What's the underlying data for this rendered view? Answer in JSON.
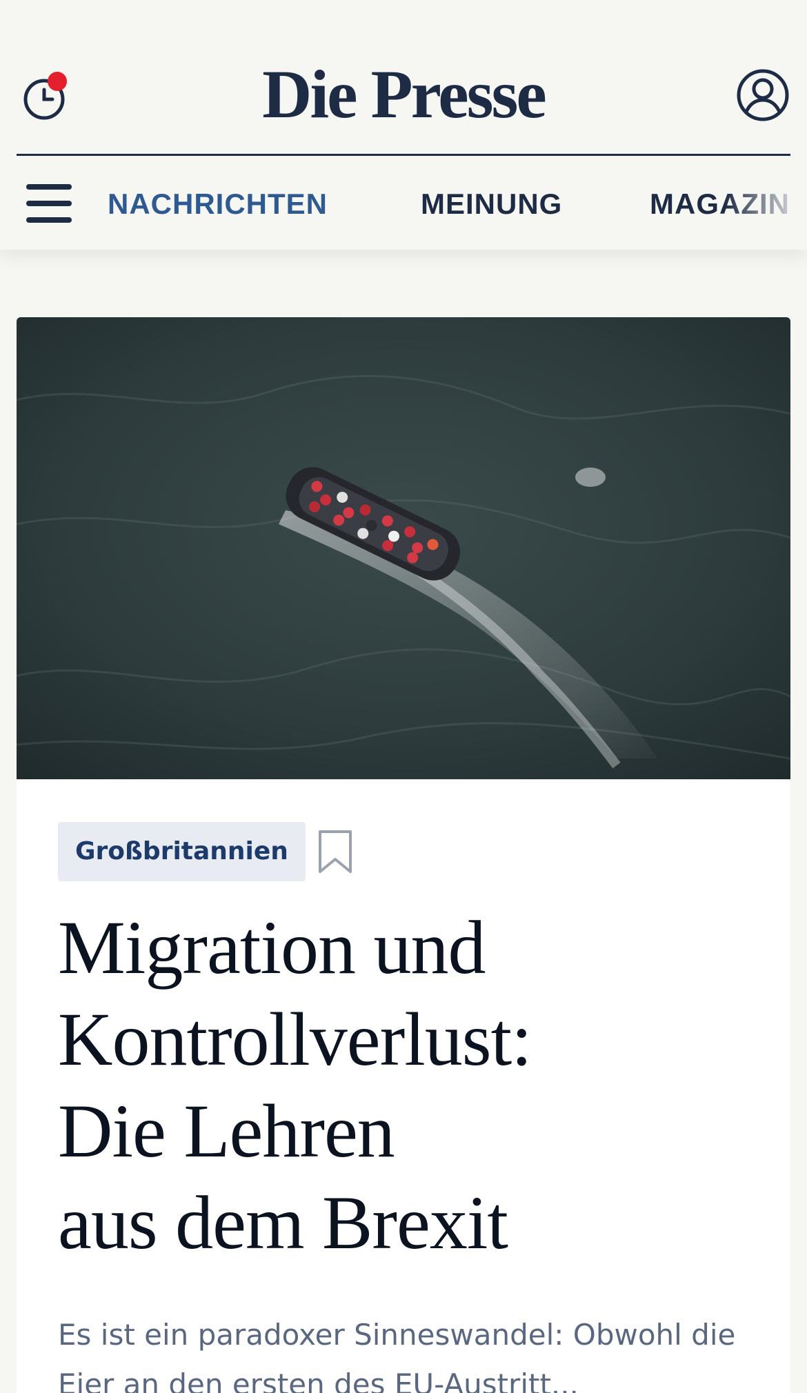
{
  "header": {
    "logo": "Die Presse",
    "history_has_notification": true,
    "notification_color": "#e3202b",
    "history_icon": "clock-icon",
    "account_icon": "user-icon"
  },
  "nav": {
    "menu_icon": "hamburger-icon",
    "items": [
      {
        "label": "NACHRICHTEN",
        "active": true
      },
      {
        "label": "MEINUNG",
        "active": false
      },
      {
        "label": "MAGAZIN",
        "active": false
      }
    ]
  },
  "article": {
    "tag": "Großbritannien",
    "bookmark_icon": "bookmark-icon",
    "headline": "Migration und\nKontrollverlust:\nDie Lehren\naus dem Brexit",
    "lead": "Es ist ein paradoxer Sinneswandel: Obwohl die Eier an den ersten des EU-Austritt..."
  },
  "colors": {
    "brand": "#1d2b45",
    "nav_active": "#2e5a91",
    "tag_bg": "#e8ecf2",
    "page_bg": "#f6f6f3"
  }
}
